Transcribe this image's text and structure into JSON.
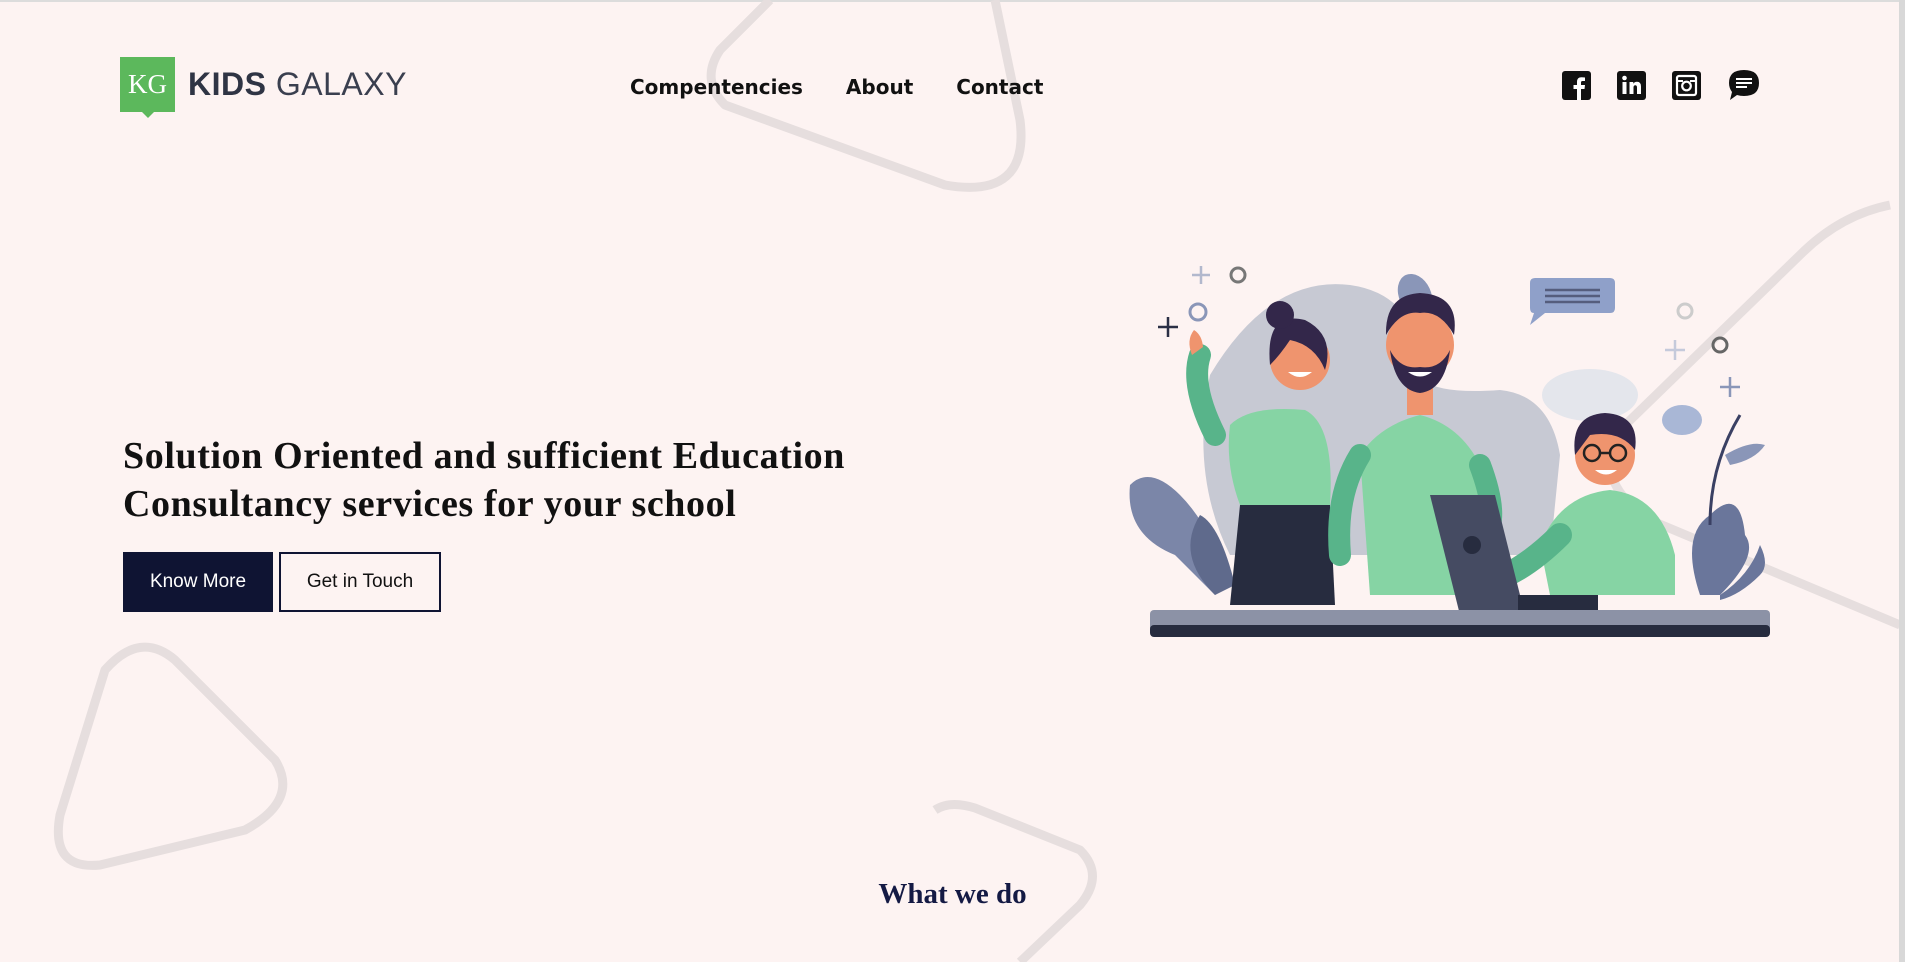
{
  "logo": {
    "mark": "KG",
    "word1": "KIDS",
    "word2": "GALAXY"
  },
  "nav": {
    "items": [
      "Compentencies",
      "About",
      "Contact"
    ]
  },
  "social": [
    "facebook-icon",
    "linkedin-icon",
    "instagram-icon",
    "chat-icon"
  ],
  "hero": {
    "title": "Solution Oriented and sufficient Education Consultancy services for your school",
    "primary_button": "Know More",
    "secondary_button": "Get in Touch"
  },
  "section": {
    "title": "What we do"
  },
  "colors": {
    "background": "#fdf3f2",
    "brand_green": "#5cb85c",
    "navy": "#0f1433",
    "illustration_green": "#86d4a4"
  }
}
